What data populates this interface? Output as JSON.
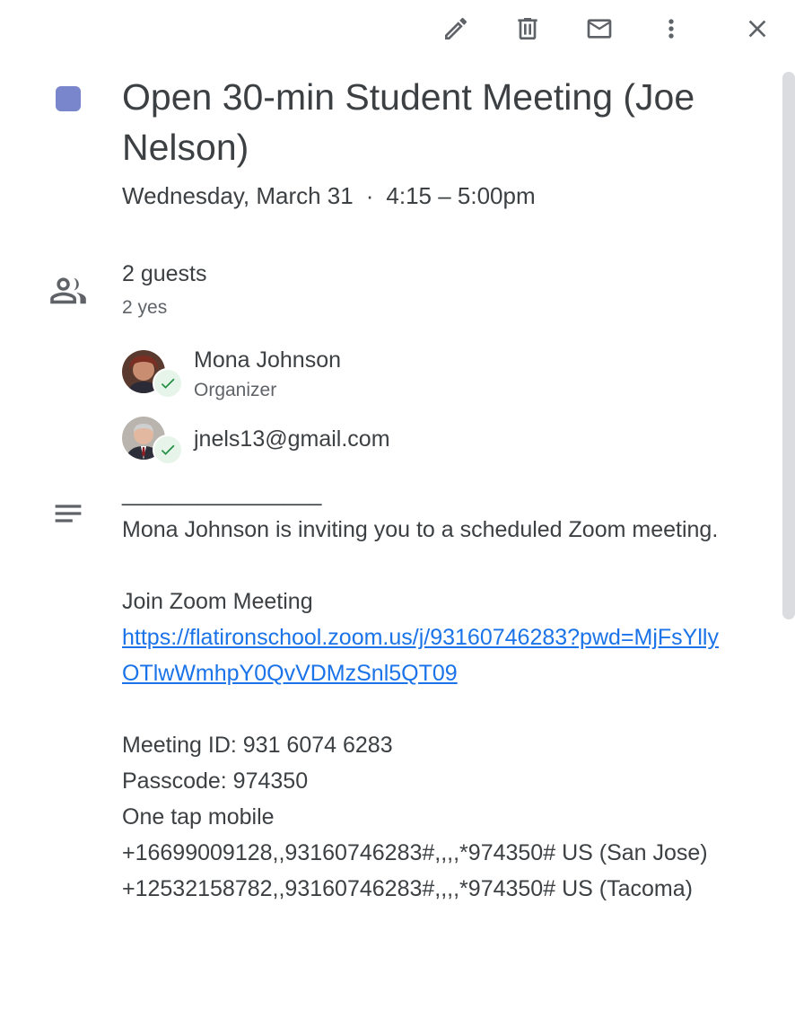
{
  "toolbar": {
    "edit_icon": "pencil-icon",
    "delete_icon": "trash-icon",
    "email_icon": "mail-icon",
    "more_icon": "more-vert-icon",
    "close_icon": "close-icon"
  },
  "event": {
    "color": "#7986cb",
    "title": "Open 30-min Student Meeting (Joe Nelson)",
    "date": "Wednesday, March 31",
    "separator": "·",
    "time": "4:15 – 5:00pm"
  },
  "guests": {
    "count": "2 guests",
    "summary": "2 yes",
    "list": [
      {
        "name": "Mona Johnson",
        "role": "Organizer",
        "status_icon": "check-icon"
      },
      {
        "name": "jnels13@gmail.com",
        "role": "",
        "status_icon": "check-icon"
      }
    ]
  },
  "description": {
    "rule": "________________",
    "lines": [
      "Mona Johnson is inviting you to a scheduled Zoom meeting.",
      "Join Zoom Meeting",
      "Meeting ID: 931 6074 6283",
      "Passcode: 974350",
      "One tap mobile",
      "+16699009128,,93160746283#,,,,*974350# US (San Jose)",
      "+12532158782,,93160746283#,,,,*974350# US (Tacoma)"
    ],
    "link": "https://flatironschool.zoom.us/j/93160746283?pwd=MjFsYllyOTlwWmhpY0QvVDMzSnl5QT09"
  },
  "colors": {
    "link": "#1a73e8",
    "accepted": "#1e8e3e"
  }
}
